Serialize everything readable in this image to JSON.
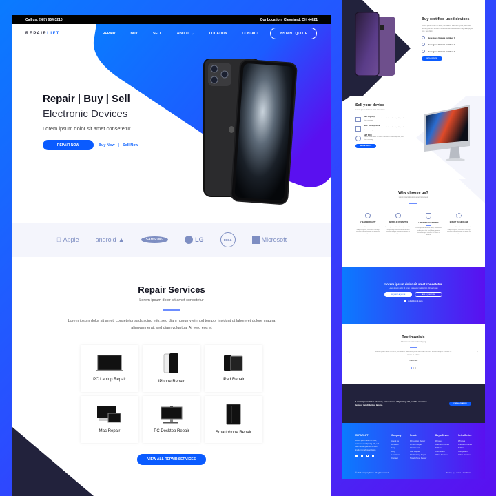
{
  "topbar": {
    "phone": "Call us: (987) 654-3210",
    "location": "Our Location: Cleveland, OH 44621"
  },
  "nav": {
    "logo_primary": "REPAIR",
    "logo_accent": "LIFT",
    "links": [
      "REPAIR",
      "BUY",
      "SELL",
      "ABOUT",
      "LOCATION",
      "CONTACT"
    ],
    "quote_button": "INSTANT QUOTE"
  },
  "hero": {
    "title": "Repair | Buy | Sell",
    "subtitle": "Electronic Devices",
    "description": "Lorem ipsum dolor sit amet consetetur",
    "repair_button": "REPAIR NOW",
    "buy_link": "Buy Now",
    "separator": "|",
    "sell_link": "Sell Now"
  },
  "brands": [
    "Apple",
    "android",
    "SAMSUNG",
    "LG",
    "DELL",
    "Microsoft"
  ],
  "services": {
    "title": "Repair Services",
    "subtitle": "Lorem ipsum dolor sit amet consetetur",
    "body": "Lorem ipsum dolor sit amet, consetetur sadipscing elitr, sed diam nonumy eirmod tempor invidunt ut labore et dolore magna aliquyam erat, sed diam voluptua. At vero eos et",
    "cards": [
      "PC Laptop Repair",
      "iPhone Repair",
      "iPad Repair",
      "Mac Repair",
      "PC Desktop Repair",
      "Smartphone Repair"
    ],
    "view_all": "VIEW ALL REPAIR SERVICES"
  },
  "buy_section": {
    "title": "Buy certified used devices",
    "body": "Lorem ipsum dolor sit amet, consetetur sadipscing elitr, sed diam nonumy eirmod tempor invidunt ut labore et dolore magna aliquyam erat, sed diam",
    "features": [
      "Here goes feature number 1",
      "Here goes feature number 2",
      "Here goes feature number 3"
    ],
    "button": "BUY A DEVICE"
  },
  "sell_section": {
    "title": "Sell your device",
    "subtitle": "Lorem ipsum dolor sit amet consetetur",
    "steps": [
      {
        "title": "GET A QUOTE",
        "body": "Lorem ipsum dolor sit amet, consetetur sadipscing elitr, sed diam nonumy."
      },
      {
        "title": "SHIP YOUR DEVICE",
        "body": "Lorem ipsum dolor sit amet, consetetur sadipscing elitr, sed diam nonumy."
      },
      {
        "title": "GET PAID",
        "body": "Lorem ipsum dolor sit amet, consetetur sadipscing elitr, sed diam nonumy."
      }
    ],
    "button": "SELL A DEVICE"
  },
  "why_section": {
    "title": "Why choose us?",
    "subtitle": "Lorem ipsum dolor sit amet consetetur",
    "items": [
      {
        "title": "1 YEAR WARRANTY",
        "body": "Lorem ipsum dolor sit amet, consetetur sadipscing elitr, sed diam nonumy eirmod tempor invidunt ut labore et dolore"
      },
      {
        "title": "REPAIRS IN 45 MINUTES",
        "body": "Lorem ipsum dolor sit amet, consetetur sadipscing elitr, sed diam nonumy eirmod tempor invidunt ut labore et dolore"
      },
      {
        "title": "LOW PRICE GUARANTEE",
        "body": "Lorem ipsum dolor sit amet, consetetur sadipscing elitr, sed diam nonumy eirmod tempor invidunt ut labore et dolore"
      },
      {
        "title": "EXPERT TECHNICIANS",
        "body": "Lorem ipsum dolor sit amet, consetetur sadipscing elitr, sed diam nonumy eirmod tempor invidunt ut labore et dolore"
      }
    ]
  },
  "cta_section": {
    "title": "Lorem ipsum dolor sit amet consetetur",
    "subtitle": "Lorem ipsum dolor sit amet, consetetur sadipscing elitr sed diam",
    "primary_button": "REQUEST A QUOTE",
    "secondary_button": "ASK A QUESTION",
    "note": "submit form & quote"
  },
  "testimonials": {
    "title": "Testimonials",
    "subtitle": "What Our Customers Are Saying",
    "quote": "Lorem ipsum dolor sit amet, consetetur sadipscing elitr, sed diam nonumy eirmod tempor invidunt ut labore et dolore",
    "author": "- John Doe"
  },
  "newsletter": {
    "text": "Lorem ipsum dolor sit amet, consectetur adipiscing elit, sed do eiusmod tempor incididunt ut labore.",
    "button": "FIND A LOCATION"
  },
  "footer": {
    "brand": "REPAIRLIFT",
    "about": "Lorem ipsum dolor sit amet, consetetur sadipscing elitr, sed diam nonumy eirmod tempor invidunt ut labore et dolore",
    "columns": [
      {
        "title": "Company",
        "items": [
          "About us",
          "Reviews",
          "FAQ",
          "Blog",
          "Locations",
          "Contact"
        ]
      },
      {
        "title": "Repair",
        "items": [
          "PC Laptop Repair",
          "iPhone Repair",
          "iPad Repair",
          "Mac Repair",
          "PC Desktop Repair",
          "Smartphone Repair"
        ]
      },
      {
        "title": "Buy a Device",
        "items": [
          "iPhones",
          "Android Phones",
          "Tablets",
          "Computers",
          "Other Devices"
        ]
      },
      {
        "title": "Sell a Device",
        "items": [
          "iPhones",
          "Android Phones",
          "Tablets",
          "Computers",
          "Other Devices"
        ]
      }
    ],
    "copyright": "© 2020 Company Name. All rights reserved.",
    "legal": [
      "Privacy",
      "Terms & Conditions"
    ]
  },
  "colors": {
    "primary": "#0a5bff",
    "gradient_start": "#0a7bff",
    "gradient_end": "#5a10f0",
    "dark": "#22223c",
    "brand_logo": "#7e8ec2"
  }
}
